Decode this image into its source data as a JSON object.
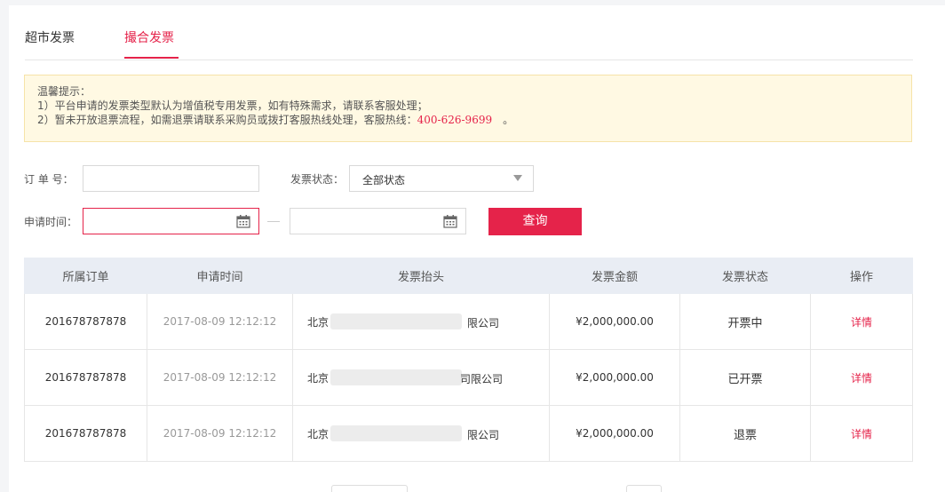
{
  "tabs": [
    {
      "label": "超市发票"
    },
    {
      "label": "撮合发票"
    }
  ],
  "notice": {
    "title": "温馨提示：",
    "line1": "1）平台申请的发票类型默认为增值税专用发票，如有特殊需求，请联系客服处理；",
    "line2_prefix": "2）暂未开放退票流程，如需退票请联系采购员或拨打客服热线处理，客服热线：",
    "phone": "400-626-9699",
    "line2_suffix": "　。"
  },
  "filters": {
    "order_label": "订 单 号：",
    "order_value": "",
    "status_label": "发票状态：",
    "status_value": "全部状态",
    "time_label": "申请时间：",
    "query_button": "查询"
  },
  "table": {
    "headers": [
      "所属订单",
      "申请时间",
      "发票抬头",
      "发票金额",
      "发票状态",
      "操作"
    ],
    "rows": [
      {
        "order": "201678787878",
        "time": "2017-08-09 12:12:12",
        "title_start": "北京",
        "title_end": "限公司",
        "amount": "¥2,000,000.00",
        "status": "开票中",
        "action": "详情"
      },
      {
        "order": "201678787878",
        "time": "2017-08-09 12:12:12",
        "title_start": "北京",
        "title_end": "司限公司",
        "amount": "¥2,000,000.00",
        "status": "已开票",
        "action": "详情"
      },
      {
        "order": "201678787878",
        "time": "2017-08-09 12:12:12",
        "title_start": "北京",
        "title_end": "限公司",
        "amount": "¥2,000,000.00",
        "status": "退票",
        "action": "详情"
      }
    ]
  },
  "colors": {
    "accent": "#e5234a",
    "header_bg": "#e9edf4",
    "notice_bg": "#fff9e3"
  },
  "icons": {
    "date_picker": "calendar-icon",
    "dropdown": "chevron-down-icon"
  }
}
